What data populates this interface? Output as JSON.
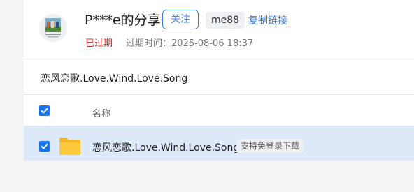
{
  "header": {
    "title": "P***e的分享",
    "follow_label": "关注",
    "share_code": "me88",
    "copy_link_label": "复制链接",
    "status": "已过期",
    "expire_time": "过期时间：2025-08-06 18:37"
  },
  "path": "恋风恋歌.Love.Wind.Love.Song",
  "list": {
    "column_name": "名称",
    "rows": [
      {
        "name": "恋风恋歌.Love.Wind.Love.Song",
        "tag": "支持免登录下载",
        "type_icon": "folder-icon"
      }
    ]
  },
  "colors": {
    "accent": "#3b7ce6",
    "expired": "#e02e2e",
    "selected_row": "#dde9f9",
    "folder": "#f9c23c"
  }
}
